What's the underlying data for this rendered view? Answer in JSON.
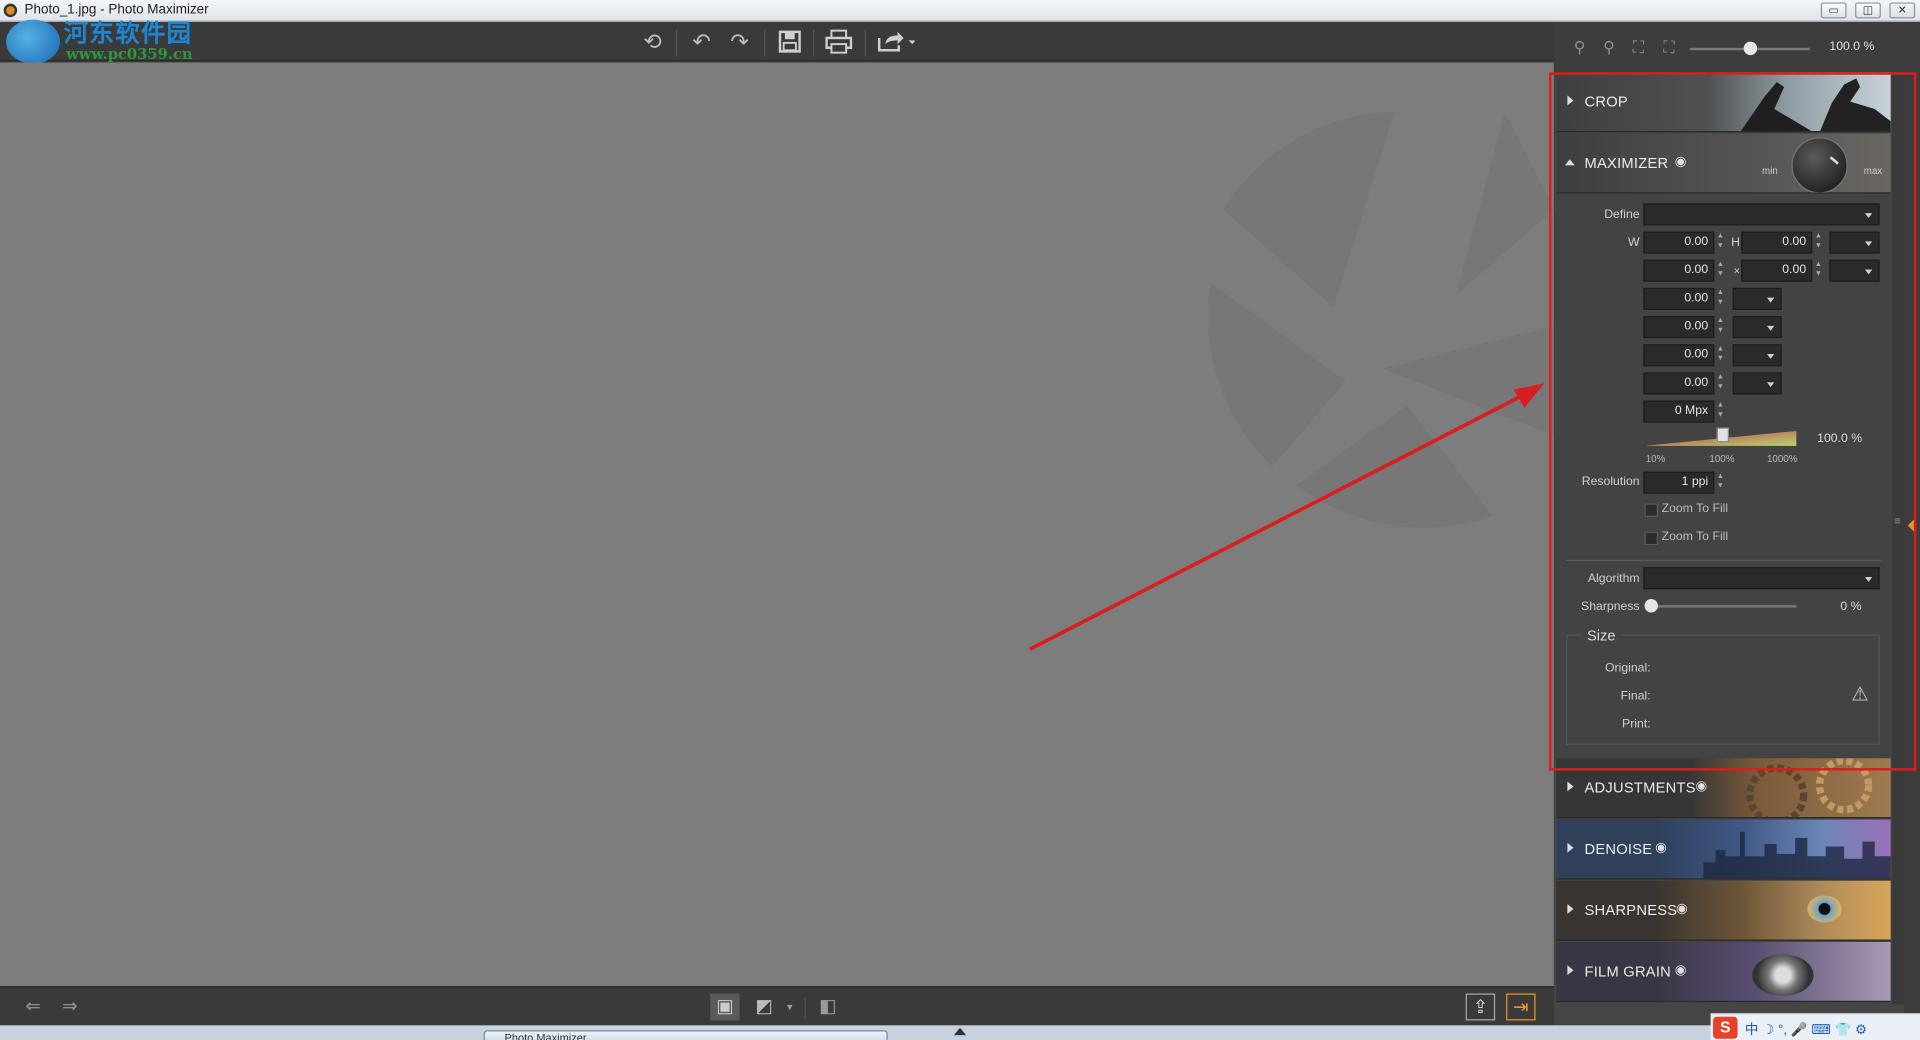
{
  "window": {
    "title": "Photo_1.jpg - Photo Maximizer",
    "min_glyph": "▭",
    "max_glyph": "◫",
    "close_glyph": "✕"
  },
  "watermark": {
    "line1": "河东软件园",
    "line2": "www.pc0359.cn"
  },
  "toolbar": {
    "icons": [
      "undo-history-icon",
      "undo-icon",
      "redo-icon",
      "save-icon",
      "print-icon",
      "share-icon"
    ]
  },
  "zoom": {
    "value": "100.0 %"
  },
  "modules": {
    "crop": {
      "label": "CROP"
    },
    "maximizer": {
      "label": "MAXIMIZER",
      "knob_min": "min",
      "knob_max": "max"
    },
    "adjustments": {
      "label": "ADJUSTMENTS"
    },
    "denoise": {
      "label": "DENOISE"
    },
    "sharpness": {
      "label": "SHARPNESS"
    },
    "film_grain": {
      "label": "FILM GRAIN"
    }
  },
  "maximizer": {
    "define_label": "Define",
    "define_value": "",
    "w_label": "W",
    "h_label": "H",
    "w_value": "0.00",
    "h_value": "0.00",
    "row2_a": "0.00",
    "x_label": "×",
    "row2_b": "0.00",
    "field3": "0.00",
    "field4": "0.00",
    "field5": "0.00",
    "field6": "0.00",
    "mpx": "0 Mpx",
    "scale_value": "100.0 %",
    "scale_position": 0.5,
    "tick_10": "10%",
    "tick_100": "100%",
    "tick_1000": "1000%",
    "resolution_label": "Resolution",
    "resolution_value": "1 ppi",
    "zoom_fill_1": "Zoom To Fill",
    "zoom_fill_2": "Zoom To Fill",
    "algorithm_label": "Algorithm",
    "algorithm_value": "",
    "sharpness_label": "Sharpness",
    "sharpness_value": "0 %",
    "size_title": "Size",
    "original_label": "Original:",
    "final_label": "Final:",
    "print_label": "Print:"
  },
  "taskbar": {
    "button_label": "Photo Maximizer"
  },
  "colors": {
    "highlight": "#e01b1b",
    "accent": "#e8962a"
  }
}
